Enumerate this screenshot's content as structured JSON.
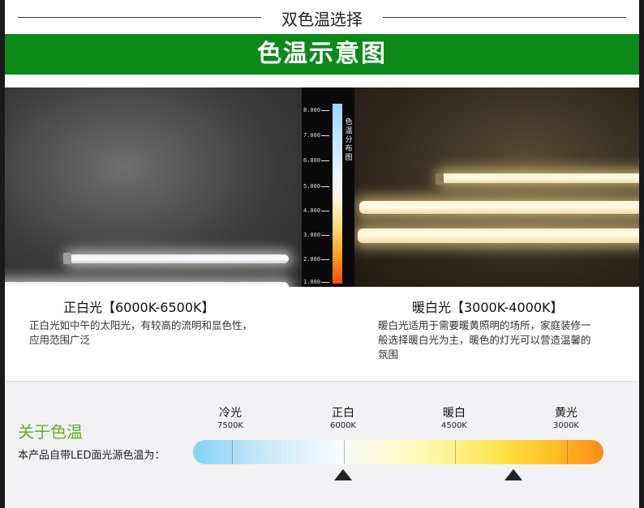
{
  "header": {
    "title": "双色温选择"
  },
  "banner": {
    "title": "色温示意图"
  },
  "scale": {
    "ticks": [
      "8.000",
      "7.000",
      "6.000",
      "5.000",
      "4.000",
      "3.000",
      "2.000",
      "1.000"
    ],
    "label": "色温分布图"
  },
  "cool": {
    "title": "正白光【6000K-6500K】",
    "desc_lines": [
      "正白光如中午的太阳光，有较高的流明和显色性，",
      "应用范围广泛"
    ]
  },
  "warm": {
    "title": "暖白光【3000K-4000K】",
    "desc_lines": [
      "暖白光适用于需要暖黄照明的场所，家庭装修一",
      "般选择暖白光为主，暖色的灯光可以营造温馨的",
      "氛围"
    ]
  },
  "about": {
    "title": "关于色温",
    "subtitle": "本产品自带LED面光源色温为：",
    "markers": [
      {
        "name": "冷光",
        "temp": "7500K"
      },
      {
        "name": "正白",
        "temp": "6000K"
      },
      {
        "name": "暖白",
        "temp": "4500K"
      },
      {
        "name": "黄光",
        "temp": "3000K"
      }
    ]
  },
  "colors": {
    "banner_green": "#0b8a1a",
    "about_green": "#5bb321"
  }
}
